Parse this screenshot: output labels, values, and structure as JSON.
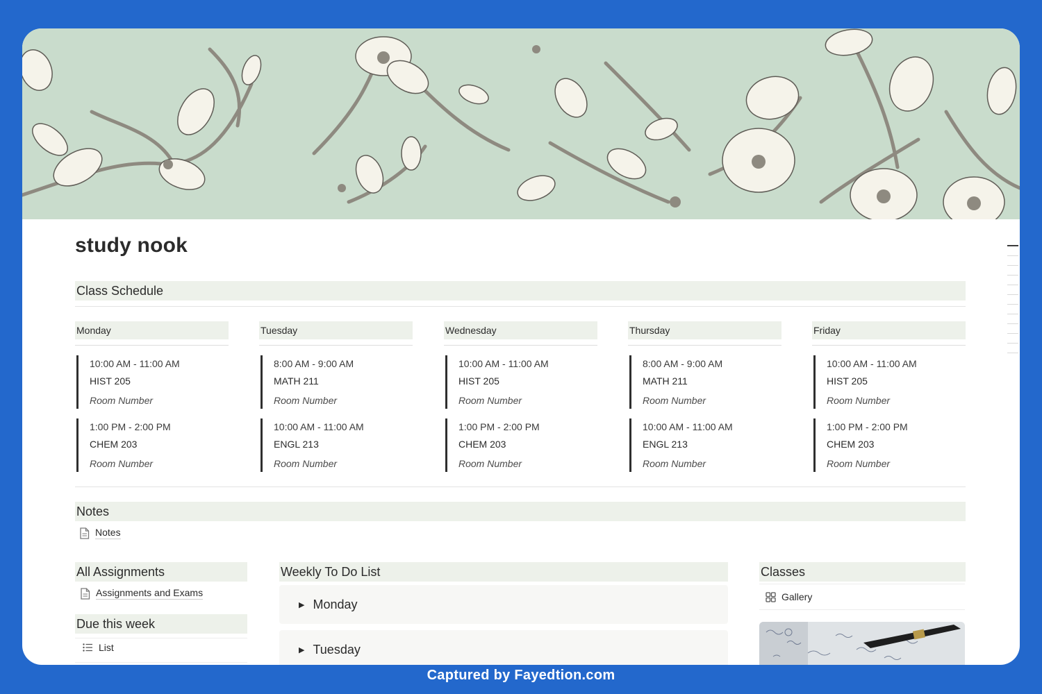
{
  "page": {
    "title": "study nook"
  },
  "schedule": {
    "header": "Class Schedule",
    "days": [
      {
        "name": "Monday",
        "slots": [
          {
            "time": "10:00 AM - 11:00 AM",
            "course": "HIST 205",
            "room": "Room Number"
          },
          {
            "time": "1:00 PM - 2:00 PM",
            "course": "CHEM 203",
            "room": "Room Number"
          }
        ]
      },
      {
        "name": "Tuesday",
        "slots": [
          {
            "time": "8:00 AM - 9:00 AM",
            "course": "MATH 211",
            "room": "Room Number"
          },
          {
            "time": "10:00 AM - 11:00 AM",
            "course": "ENGL 213",
            "room": "Room Number"
          }
        ]
      },
      {
        "name": "Wednesday",
        "slots": [
          {
            "time": "10:00 AM - 11:00 AM",
            "course": "HIST 205",
            "room": "Room Number"
          },
          {
            "time": "1:00 PM - 2:00 PM",
            "course": "CHEM 203",
            "room": "Room Number"
          }
        ]
      },
      {
        "name": "Thursday",
        "slots": [
          {
            "time": "8:00 AM - 9:00 AM",
            "course": "MATH 211",
            "room": "Room Number"
          },
          {
            "time": "10:00 AM - 11:00 AM",
            "course": "ENGL 213",
            "room": "Room Number"
          }
        ]
      },
      {
        "name": "Friday",
        "slots": [
          {
            "time": "10:00 AM - 11:00 AM",
            "course": "HIST 205",
            "room": "Room Number"
          },
          {
            "time": "1:00 PM - 2:00 PM",
            "course": "CHEM 203",
            "room": "Room Number"
          }
        ]
      }
    ]
  },
  "notes": {
    "header": "Notes",
    "link_label": "Notes",
    "link_icon": "page-icon"
  },
  "assignments": {
    "header": "All Assignments",
    "link_label": "Assignments and Exams",
    "link_icon": "page-icon"
  },
  "due_this_week": {
    "header": "Due this week",
    "view_label": "List",
    "view_icon": "list-icon"
  },
  "todo": {
    "header": "Weekly To Do List",
    "toggles": [
      "Monday",
      "Tuesday"
    ],
    "toggle_icon": "triangle-right-icon"
  },
  "classes": {
    "header": "Classes",
    "view_label": "Gallery",
    "view_icon": "gallery-icon"
  },
  "footer": {
    "caption": "Captured by Fayedtion.com"
  },
  "colors": {
    "frame": "#2368cc",
    "section_bg": "#edf1ea",
    "cover_bg": "#c9dccc",
    "accent_bar": "#2f2f2f"
  }
}
